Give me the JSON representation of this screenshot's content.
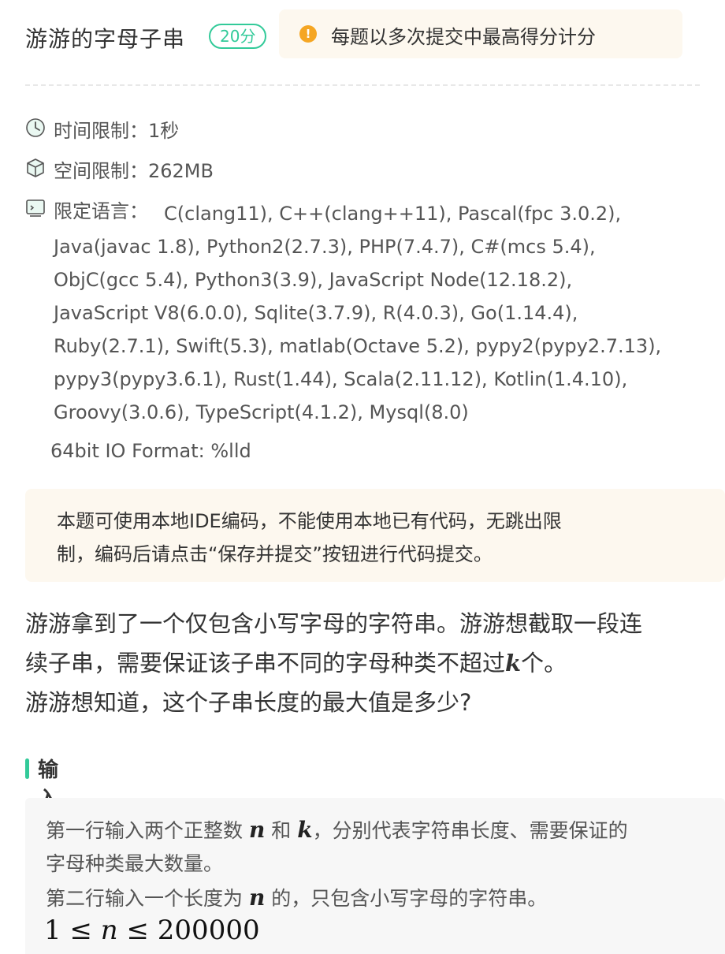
{
  "header": {
    "title": "游游的字母子串",
    "score": "20分",
    "notice": "每题以多次提交中最高得分计分",
    "notice_icon": "warning-icon"
  },
  "limits": {
    "time_label": "时间限制：",
    "time_value": "1秒",
    "space_label": "空间限制：",
    "space_value": "262MB",
    "lang_label": "限定语言：",
    "languages_lines": [
      "C(clang11), C++(clang++11), Pascal(fpc 3.0.2),",
      "Java(javac 1.8), Python2(2.7.3), PHP(7.4.7), C#(mcs 5.4),",
      "ObjC(gcc 5.4), Python3(3.9), JavaScript Node(12.18.2),",
      "JavaScript V8(6.0.0), Sqlite(3.7.9), R(4.0.3), Go(1.14.4),",
      "Ruby(2.7.1), Swift(5.3), matlab(Octave 5.2), pypy2(pypy2.7.13),",
      "pypy3(pypy3.6.1), Rust(1.44), Scala(2.11.12), Kotlin(1.4.10),",
      "Groovy(3.0.6), TypeScript(4.1.2), Mysql(8.0)"
    ],
    "io_format": "64bit IO Format: %lld"
  },
  "ide_note": {
    "line1": "本题可使用本地IDE编码，不能使用本地已有代码，无跳出限",
    "line2": "制，编码后请点击“保存并提交”按钮进行代码提交。"
  },
  "description": {
    "line1": "游游拿到了一个仅包含小写字母的字符串。游游想截取一段连",
    "line2_pre": "续子串，需要保证该子串不同的字母种类不超过",
    "line2_var": "k",
    "line2_post": "个。",
    "line3": "游游想知道，这个子串长度的最大值是多少?"
  },
  "input_section": {
    "title": "输入描述",
    "l1_a": "第一行输入两个正整数 ",
    "l1_n": "n",
    "l1_b": " 和 ",
    "l1_k": "k",
    "l1_c": "，分别代表字符串长度、需要保证的",
    "l2": "字母种类最大数量。",
    "l3_a": "第二行输入一个长度为 ",
    "l3_n": "n",
    "l3_b": " 的，只包含小写字母的字符串。",
    "c_low": "1",
    "c_op1": "≤",
    "c_var": "n",
    "c_op2": "≤",
    "c_high": "200000"
  },
  "colors": {
    "accent": "#32ca99",
    "warning": "#f5a623",
    "note_bg": "#fdf8ef"
  }
}
